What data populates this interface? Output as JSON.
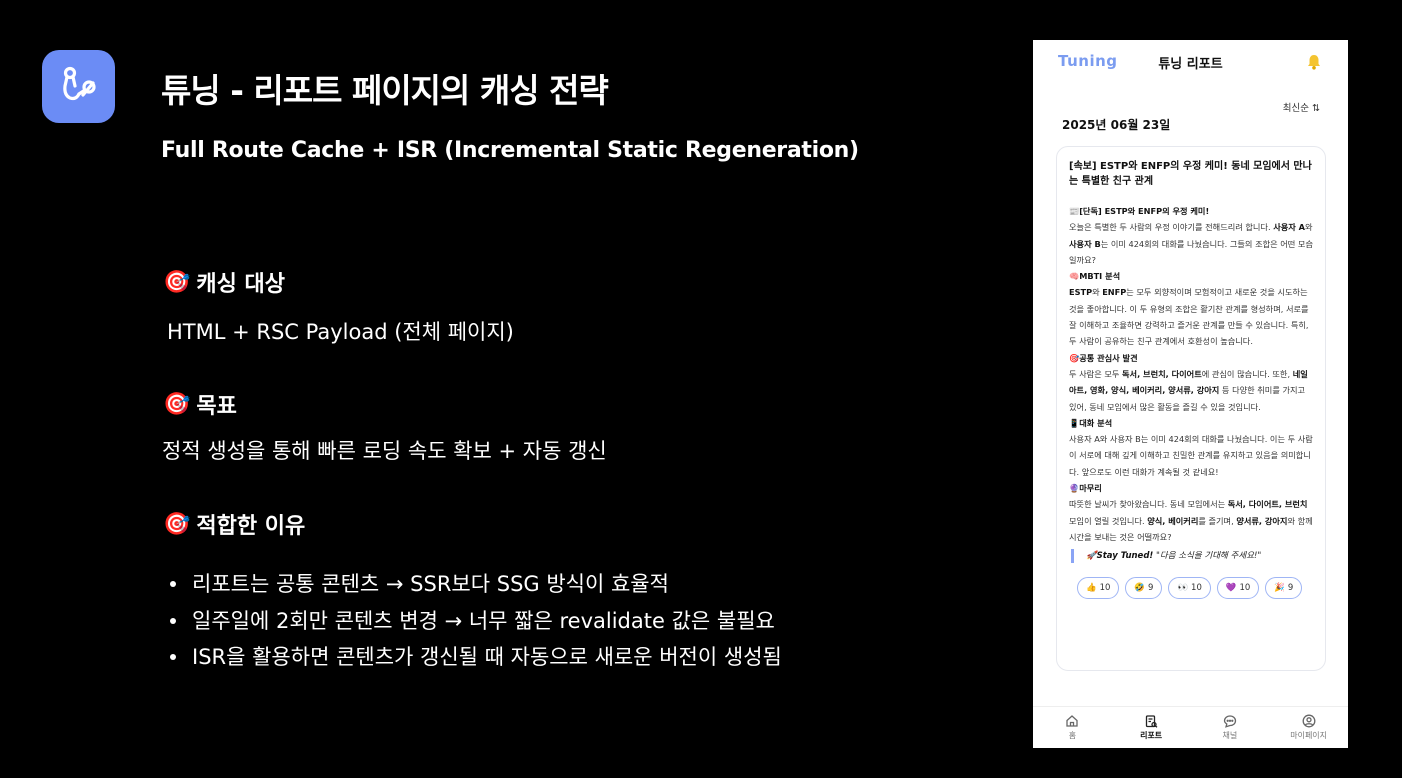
{
  "slide": {
    "title": "튜닝 - 리포트 페이지의 캐싱 전략",
    "subtitle": "Full Route Cache + ISR (Incremental Static Regeneration)",
    "sections": [
      {
        "emoji": "🎯",
        "heading": "캐싱 대상",
        "text": "HTML + RSC Payload (전체 페이지)"
      },
      {
        "emoji": "🎯",
        "heading": "목표",
        "text": "정적 생성을 통해 빠른 로딩 속도 확보 + 자동 갱신"
      },
      {
        "emoji": "🎯",
        "heading": "적합한 이유"
      }
    ],
    "bullets": [
      "리포트는 공통 콘텐츠 → SSR보다 SSG 방식이 효율적",
      "일주일에 2회만 콘텐츠 변경 → 너무 짧은 revalidate 값은 불필요",
      "ISR을 활용하면 콘텐츠가 갱신될 때 자동으로 새로운 버전이 생성됨"
    ]
  },
  "app": {
    "brand": "Tuning",
    "header_title": "튜닝 리포트",
    "sort_label": "최신순 ⇅",
    "date": "2025년 06월 23일",
    "card": {
      "title": "[속보] ESTP와 ENFP의 우정 케미! 동네 모임에서 만나는 특별한 친구 관계",
      "s1_head": "📰[단독] ESTP와 ENFP의 우정 케미!",
      "s1_a": "오늘은 특별한 두 사람의 우정 이야기를 전해드리려 합니다. ",
      "s1_b": "사용자 A",
      "s1_c": "와 ",
      "s1_d": "사용자 B",
      "s1_e": "는 이미 424회의 대화를 나눴습니다. 그들의 조합은 어떤 모습일까요?",
      "s2_head": "🧠MBTI 분석",
      "s2_a": "ESTP",
      "s2_b": "와 ",
      "s2_c": "ENFP",
      "s2_d": "는 모두 외향적이며 모험적이고 새로운 것을 시도하는 것을 좋아합니다. 이 두 유형의 조합은 활기찬 관계를 형성하며, 서로를 잘 이해하고 조율하면 강력하고 즐거운 관계를 만들 수 있습니다. 특히, 두 사람이 공유하는 친구 관계에서 호환성이 높습니다.",
      "s3_head": "🎯공통 관심사 발견",
      "s3_a": "두 사람은 모두 ",
      "s3_b": "독서, 브런치, 다이어트",
      "s3_c": "에 관심이 많습니다. 또한, ",
      "s3_d": "네일아트, 영화, 양식, 베이커리, 양서류, 강아지",
      "s3_e": " 등 다양한 취미를 가지고 있어, 동네 모임에서 많은 활동을 즐길 수 있을 것입니다.",
      "s4_head": "📱대화 분석",
      "s4_text": "사용자 A와 사용자 B는 이미 424회의 대화를 나눴습니다. 이는 두 사람이 서로에 대해 깊게 이해하고 친밀한 관계를 유지하고 있음을 의미합니다. 앞으로도 이런 대화가 계속될 것 같네요!",
      "s5_head": "🔮마무리",
      "s5_a": "따뜻한 날씨가 찾아왔습니다. 동네 모임에서는 ",
      "s5_b": "독서, 다이어트, 브런치",
      "s5_c": " 모임이 열릴 것입니다. ",
      "s5_d": "양식, 베이커리",
      "s5_e": "를 즐기며, ",
      "s5_f": "양서류, 강아지",
      "s5_g": "와 함께 시간을 보내는 것은 어떨까요?",
      "quote_bold": "🚀Stay Tuned!",
      "quote_rest": " \"다음 소식을 기대해 주세요!\""
    },
    "reactions": [
      {
        "emoji": "👍",
        "count": "10"
      },
      {
        "emoji": "🤣",
        "count": "9"
      },
      {
        "emoji": "👀",
        "count": "10"
      },
      {
        "emoji": "💜",
        "count": "10"
      },
      {
        "emoji": "🎉",
        "count": "9"
      }
    ],
    "tabs": [
      "홈",
      "리포트",
      "채널",
      "마이페이지"
    ]
  }
}
